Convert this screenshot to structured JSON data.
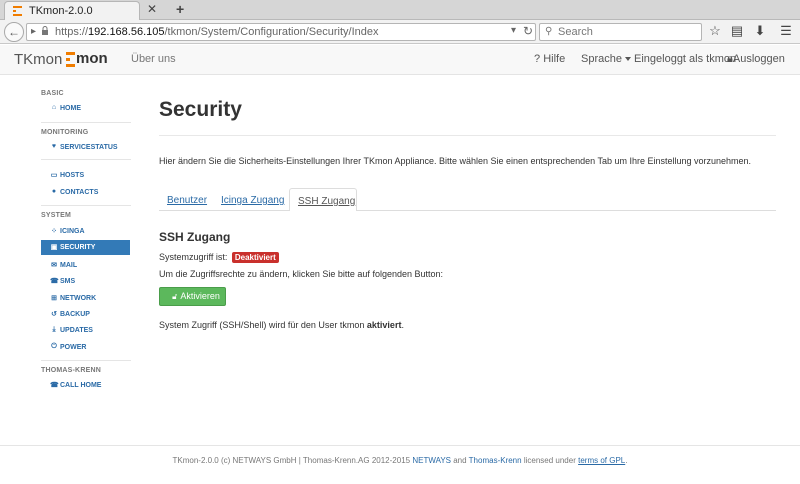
{
  "browser": {
    "tab_title": "TKmon-2.0.0",
    "url_host": "192.168.56.105",
    "url_scheme": "https://",
    "url_path": "/tkmon/System/Configuration/Security/Index",
    "search_placeholder": "Search"
  },
  "navbar": {
    "brand": "TKmon",
    "logo_text": "mon",
    "about": "Über uns",
    "help": "Hilfe",
    "language": "Sprache",
    "logged_in": "Eingeloggt als tkmon",
    "logout": "Ausloggen"
  },
  "sidebar": {
    "sections": [
      {
        "title": "BASIC",
        "items": [
          {
            "label": "HOME",
            "icon": "home-icon"
          }
        ]
      },
      {
        "title": "MONITORING",
        "items": [
          {
            "label": "SERVICESTATUS",
            "icon": "heart-icon"
          },
          {
            "label": "HOSTS",
            "icon": "monitor-icon"
          },
          {
            "label": "CONTACTS",
            "icon": "user-icon"
          }
        ]
      },
      {
        "title": "SYSTEM",
        "items": [
          {
            "label": "ICINGA",
            "icon": "icinga-icon"
          },
          {
            "label": "SECURITY",
            "icon": "lock-icon",
            "active": true
          },
          {
            "label": "MAIL",
            "icon": "mail-icon"
          },
          {
            "label": "SMS",
            "icon": "phone-icon"
          },
          {
            "label": "NETWORK",
            "icon": "network-icon"
          },
          {
            "label": "BACKUP",
            "icon": "backup-icon"
          },
          {
            "label": "UPDATES",
            "icon": "download-icon"
          },
          {
            "label": "POWER",
            "icon": "power-icon"
          }
        ]
      },
      {
        "title": "THOMAS-KRENN",
        "items": [
          {
            "label": "CALL HOME",
            "icon": "phone-icon"
          }
        ]
      }
    ]
  },
  "main": {
    "title": "Security",
    "intro": "Hier ändern Sie die Sicherheits-Einstellungen Ihrer TKmon Appliance. Bitte wählen Sie einen entsprechenden Tab um Ihre Einstellung vorzunehmen.",
    "tabs": [
      "Benutzer",
      "Icinga Zugang",
      "SSH Zugang"
    ],
    "active_tab": "SSH Zugang",
    "section_title": "SSH Zugang",
    "access_label": "Systemzugriff ist:",
    "access_status": "Deaktiviert",
    "hint": "Um die Zugriffsrechte zu ändern, klicken Sie bitte auf folgenden Button:",
    "button": "Aktivieren",
    "status_prefix": "System Zugriff (SSH/Shell) wird für den User tkmon",
    "status_value": "aktiviert",
    "status_suffix": "."
  },
  "footer": {
    "text_prefix": "TKmon-2.0.0 (c) NETWAYS GmbH | Thomas-Krenn.AG 2012-2015",
    "link_netways": "NETWAYS",
    "and": "and",
    "link_tk": "Thomas-Krenn",
    "licensed": "licensed under",
    "link_gpl": "terms of GPL",
    "end": "."
  },
  "colors": {
    "accent": "#337ab7",
    "link": "#2a6aa6",
    "success": "#5cb85c",
    "danger": "#c9302c",
    "brand_orange": "#f07d00"
  }
}
